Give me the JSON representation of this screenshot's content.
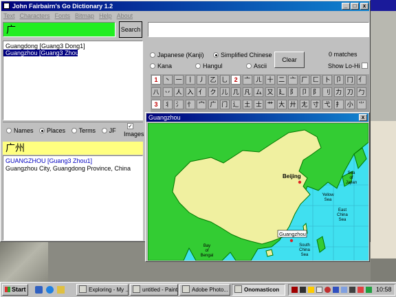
{
  "dictionary_window": {
    "title": "John Fairbairn's Go Dictionary 1.2",
    "menu": [
      "Text",
      "Characters",
      "Fonts",
      "Bitmap",
      "Help",
      "About"
    ],
    "search_value": "广",
    "search_label": "Search",
    "results": [
      "Guangdong [Guang3 Dong1]",
      "Guangzhou [Guang3 Zhou1]"
    ],
    "script_options": [
      "Japanese (Kanji)",
      "Simplified Chinese",
      "Kana",
      "Hangul",
      "Ascii"
    ],
    "clear_label": "Clear",
    "matches": "0 matches",
    "show_lohi": "Show Lo-Hi",
    "radical_row1": [
      "1",
      "丶",
      "一",
      "丨",
      "丿",
      "乙",
      "乚",
      "2",
      "亠",
      "ㄦ",
      "十",
      "二",
      "亠",
      "厂",
      "匚",
      "卜",
      "卩",
      "冂",
      "亻"
    ],
    "radical_row2": [
      "八",
      "丷",
      "人",
      "入",
      "亻",
      "ク",
      "儿",
      "几",
      "凡",
      "ム",
      "又",
      "廴",
      "阝",
      "卩",
      "阝",
      "刂",
      "力",
      "刀",
      "勹"
    ],
    "radical_row3": [
      "3",
      "丬",
      "氵",
      "忄",
      "宀",
      "广",
      "门",
      "辶",
      "土",
      "士",
      "艹",
      "大",
      "廾",
      "尢",
      "寸",
      "弋",
      "扌",
      "小",
      "⺌"
    ],
    "category_options": [
      "Names",
      "Places",
      "Terms",
      "JF"
    ],
    "images_label": "Images",
    "entry_header": "广州",
    "entry_heading": "GUANGZHOU  [Guang3 Zhou1]",
    "entry_text": "Guangzhou City, Guangdong Province, China"
  },
  "map_window": {
    "title": "Guangzhou",
    "labels": {
      "beijing": "Beijing",
      "guangzhou": "Guangzhou",
      "sea_of_japan": [
        "Sea",
        "of",
        "Japan"
      ],
      "yellow_sea": [
        "Yellow",
        "Sea"
      ],
      "east_china_sea": [
        "East",
        "China",
        "Sea"
      ],
      "bay_of_bengal": [
        "Bay",
        "of",
        "Bengal"
      ],
      "south_china_sea": [
        "South",
        "China",
        "Sea"
      ]
    },
    "colors": {
      "land_china": "#f0f0a0",
      "land_other": "#33cc33",
      "sea": "#40e0f0",
      "marker": "#e02020"
    }
  },
  "taskbar": {
    "start_label": "Start",
    "tasks": [
      "Exploring - My ...",
      "untitled - Paint",
      "Adobe Photo...",
      "Onomasticon"
    ],
    "time": "10:58"
  },
  "desktop_windows": {
    "min_label": "_",
    "max_label": "□",
    "close_label": "x"
  }
}
